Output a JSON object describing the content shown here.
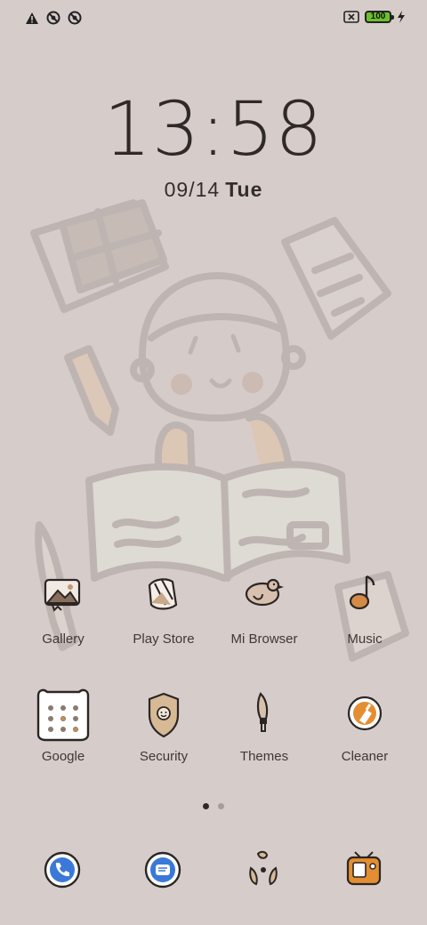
{
  "status": {
    "left_icons": [
      "warning-icon",
      "blocked-circle-icon",
      "blocked-circle-icon"
    ],
    "battery_level": "100",
    "charging": true,
    "colors": {
      "battery_fill": "#6cc02b"
    }
  },
  "clock": {
    "time": "13:58",
    "date": "09/14",
    "day": "Tue"
  },
  "apps_row1": [
    {
      "label": "Gallery",
      "icon": "gallery-icon"
    },
    {
      "label": "Play Store",
      "icon": "play-store-icon"
    },
    {
      "label": "Mi Browser",
      "icon": "browser-bird-icon"
    },
    {
      "label": "Music",
      "icon": "music-note-icon"
    }
  ],
  "apps_row2": [
    {
      "label": "Google",
      "icon": "google-folder-icon"
    },
    {
      "label": "Security",
      "icon": "security-shield-icon"
    },
    {
      "label": "Themes",
      "icon": "themes-brush-icon"
    },
    {
      "label": "Cleaner",
      "icon": "cleaner-icon"
    }
  ],
  "page_indicator": {
    "pages": 2,
    "current": 1
  },
  "dock": [
    {
      "icon": "phone-icon"
    },
    {
      "icon": "messages-icon"
    },
    {
      "icon": "camera-icon"
    },
    {
      "icon": "file-manager-icon"
    }
  ]
}
